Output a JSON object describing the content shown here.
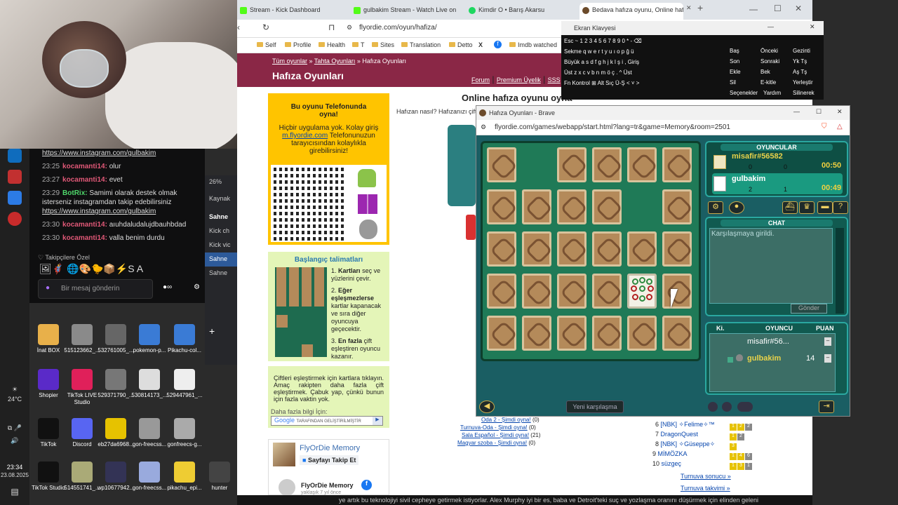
{
  "chat": {
    "messages": [
      {
        "time": "",
        "user": "",
        "text": "",
        "link": "https://www.instagram.com/gulbakim"
      },
      {
        "time": "23:25",
        "user": "kocamanti14:",
        "text": "olur",
        "link": ""
      },
      {
        "time": "23:27",
        "user": "kocamanti14:",
        "text": "evet",
        "link": ""
      },
      {
        "time": "23:29",
        "user": "BotRix:",
        "text": "Samimi olarak destek olmak isterseniz instagramdan takip edebilirsiniz",
        "link": "https://www.instagram.com/gulbakim"
      },
      {
        "time": "23:30",
        "user": "kocamanti14:",
        "text": "aıuhdaludalujdbauhbdad",
        "link": ""
      },
      {
        "time": "23:30",
        "user": "kocamanti14:",
        "text": "valla benim durdu",
        "link": ""
      }
    ],
    "followers_label": "Takipçilere Özel",
    "input_placeholder": "Bir mesaj gönderin",
    "emotes": "🖼🦸‍♂️ 🌐🎨🐤📦⚡S A"
  },
  "obs": {
    "zoom": "26%",
    "items": [
      "Kaynak",
      "Sahne",
      "Kick ch",
      "Kick vic",
      "Sahne",
      "Sahne"
    ]
  },
  "desktop_icons": [
    {
      "label": "İnat BOX"
    },
    {
      "label": "515123662_..."
    },
    {
      "label": "532761005_..."
    },
    {
      "label": "pokemon-p..."
    },
    {
      "label": "Pikachu-col..."
    },
    {
      "label": "Shopier"
    },
    {
      "label": "TikTok LIVE Studio"
    },
    {
      "label": "529371790_..."
    },
    {
      "label": "530814173_..."
    },
    {
      "label": "529447961_..."
    },
    {
      "label": "TikTok"
    },
    {
      "label": "Discord"
    },
    {
      "label": "eb27da6968..."
    },
    {
      "label": "gon-freecss..."
    },
    {
      "label": "gonfreecs-g..."
    },
    {
      "label": "TikTok Studio"
    },
    {
      "label": "514551741_..."
    },
    {
      "label": "wp10677942..."
    },
    {
      "label": "gon-freecss..."
    },
    {
      "label": "pikachu_epi..."
    },
    {
      "label": "hunter"
    }
  ],
  "taskbar": {
    "weather": "24°C",
    "time": "23:34",
    "date": "23.08.2025"
  },
  "browser": {
    "tabs": [
      {
        "label": "Stream - Kick Dashboard",
        "color": "#53fc18"
      },
      {
        "label": "gulbakim Stream - Watch Live on",
        "color": "#53fc18"
      },
      {
        "label": "Kimdir O • Barış Akarsu",
        "color": "#1ed760"
      },
      {
        "label": "Bedava hafıza oyunu, Online hafı",
        "color": "#6b4a2a"
      }
    ],
    "new_tab": "+",
    "url": "flyordie.com/oyun/hafiza/",
    "bookmarks": [
      "Self",
      "Profile",
      "Health",
      "T",
      "Sites",
      "Translation",
      "Detto",
      "X",
      "f",
      "Imdb watched"
    ]
  },
  "site": {
    "breadcrumb": [
      "Tüm oyunlar",
      "Tahta Oyunları",
      "Hafıza Oyunları"
    ],
    "title": "Hafıza Oyunları",
    "nav": [
      "Forum",
      "Premium Üyelik",
      "SSS"
    ],
    "phone_title": "Bu oyunu Telefonunda oyna!",
    "phone_text_1": "Hiçbir uygulama yok. Kolay giriş",
    "phone_link": "m.flyordie.com",
    "phone_text_2": "Telefonunuzun tarayıcısından kolaylıkla girebilirsiniz!",
    "instructions_title": "Başlangıç talimatları",
    "steps": [
      {
        "num": "1.",
        "bold": "Kartları",
        "text": "seç ve yüzlerini çevir."
      },
      {
        "num": "2.",
        "bold": "Eğer eşleşmezlerse",
        "text": "kartlar kapanacak ve sıra diğer oyuncuya geçecektir."
      },
      {
        "num": "3.",
        "bold": "En fazla",
        "text": "çift eşleştiren oyuncu kazanır."
      }
    ],
    "rules_text": "Çiftleri eşleştirmek için kartlara tıklayın. Amaç rakipten daha fazla çift eşleştirmek. Çabuk yap, çünkü bunun için fazla vaktin yok.",
    "more_info": "Daha fazla bilgi İçin:",
    "google_label": "Google",
    "google_sub": "TARAFINDAN GELİŞTİRİLMİŞTİR",
    "fb_title": "FlyOrDie Memory",
    "fb_follow": "Sayfayı Takip Et",
    "fb_title2": "FlyOrDie Memory",
    "fb_time": "yaklaşık 7 yıl önce",
    "main_heading": "Online hafıza oyunu oyna",
    "main_intro": "Hafızan nasıl? Hafızanızı çift",
    "rooms": [
      {
        "name": "Oda 2 - Şimdi oyna!",
        "count": "(0)"
      },
      {
        "name": "Turnuva-Oda - Şimdi oyna!",
        "count": "(0)"
      },
      {
        "name": "Sala Español - Şimdi oyna!",
        "count": "(21)"
      },
      {
        "name": "Magyar szoba - Şimdi oyna!",
        "count": "(0)"
      }
    ],
    "ranking": [
      {
        "rank": "6",
        "name": "[NBK] ✧Felime✧™"
      },
      {
        "rank": "7",
        "name": "DragonQuest"
      },
      {
        "rank": "8",
        "name": "[NBK] ✧Güseppe✧"
      },
      {
        "rank": "9",
        "name": "MİMÖZKA"
      },
      {
        "rank": "10",
        "name": "süzgeç"
      }
    ],
    "tournament_result": "Turnuva sonucu »",
    "tournament_calendar": "Turnuva takvimi »",
    "ticker": "ye artık bu teknolojiyi sivil cepheye getirmek istiyorlar. Alex Murphy iyi bir es, baba ve Detroit'teki suç ve yozlaşma oranını düşürmek için elinden geleni"
  },
  "keyboard": {
    "title": "Ekran Klavyesi",
    "rows": [
      "Esc ~ 1 2 3 4 5 6 7 8 9 0 * - ⌫",
      "Sekme q w e r t y u ı o p ğ ü",
      "Büyük a s d f g h j k l ş i , Giriş",
      "Üst z x c v b n m ö ç . ^ Üst",
      "Fn Kontrol ⊞ Alt Sıç Ü-Ş < ˅ >"
    ],
    "side": [
      [
        "Baş",
        "Önceki",
        "Gezinti"
      ],
      [
        "Son",
        "Sonraki",
        "Yk Tş"
      ],
      [
        "Ekle",
        "Bek",
        "Aş Tş"
      ],
      [
        "Sil",
        "E-kitle",
        "Yerleştir"
      ],
      [
        "Seçenekler",
        "Yardım",
        "Silinerek"
      ]
    ]
  },
  "game": {
    "window_title": "Hafıza Oyunları - Brave",
    "url": "flyordie.com/games/webapp/start.html?lang=tr&game=Memory&room=2501",
    "players_title": "OYUNCULAR",
    "players": [
      {
        "name": "misafir#56582",
        "score_a": "0",
        "score_b": "0",
        "time": "00:50"
      },
      {
        "name": "gulbakim",
        "score_a": "2",
        "score_b": "1",
        "time": "00:49"
      }
    ],
    "chat_title": "CHAT",
    "chat_text": "Karşılaşmaya girildi.",
    "send_button": "Gönder",
    "table_headers": [
      "Ki.",
      "OYUNCU",
      "PUAN"
    ],
    "table_rows": [
      {
        "name": "misafir#56...",
        "score": ""
      },
      {
        "name": "gulbakim",
        "score": "14"
      }
    ],
    "new_game": "Yeni karşılaşma"
  }
}
